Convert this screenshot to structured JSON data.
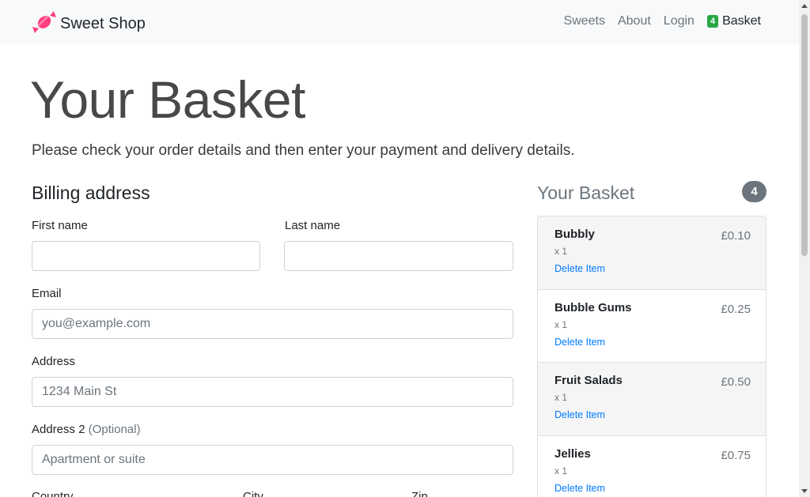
{
  "brand": {
    "name": "Sweet Shop",
    "icon": "candy-icon"
  },
  "nav": {
    "links": [
      "Sweets",
      "About",
      "Login"
    ],
    "basket_count": "4",
    "basket_label": "Basket"
  },
  "page": {
    "title": "Your Basket",
    "lead": "Please check your order details and then enter your payment and delivery details."
  },
  "billing": {
    "heading": "Billing address",
    "first_name": {
      "label": "First name",
      "value": "",
      "placeholder": ""
    },
    "last_name": {
      "label": "Last name",
      "value": "",
      "placeholder": ""
    },
    "email": {
      "label": "Email",
      "value": "",
      "placeholder": "you@example.com"
    },
    "address": {
      "label": "Address",
      "value": "",
      "placeholder": "1234 Main St"
    },
    "address2": {
      "label": "Address 2",
      "optional": "(Optional)",
      "value": "",
      "placeholder": "Apartment or suite"
    },
    "country": {
      "label": "Country"
    },
    "city": {
      "label": "City"
    },
    "zip": {
      "label": "Zip"
    }
  },
  "basket": {
    "heading": "Your Basket",
    "count": "4",
    "items": [
      {
        "name": "Bubbly",
        "qty": "x 1",
        "price": "£0.10",
        "delete": "Delete Item"
      },
      {
        "name": "Bubble Gums",
        "qty": "x 1",
        "price": "£0.25",
        "delete": "Delete Item"
      },
      {
        "name": "Fruit Salads",
        "qty": "x 1",
        "price": "£0.50",
        "delete": "Delete Item"
      },
      {
        "name": "Jellies",
        "qty": "x 1",
        "price": "£0.75",
        "delete": "Delete Item"
      }
    ]
  },
  "colors": {
    "accent": "#007bff",
    "badge": "#28a745",
    "muted": "#6c757d",
    "candy": "#ff3f7f"
  }
}
